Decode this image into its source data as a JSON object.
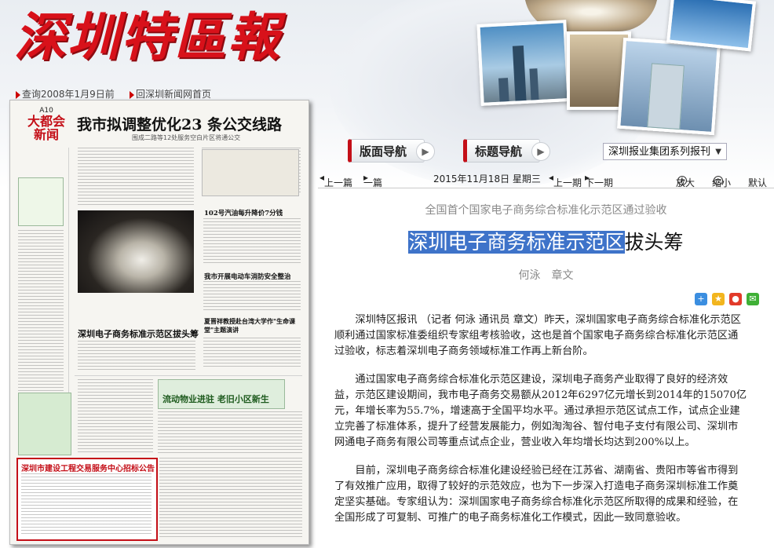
{
  "header": {
    "masthead": "深圳特區報",
    "links": [
      {
        "label": "查询2008年1月9日前"
      },
      {
        "label": "回深圳新闻网首页"
      }
    ]
  },
  "nav": {
    "layout_nav_label": "版面导航",
    "title_nav_label": "标题导航",
    "newspaper_select": "深圳报业集团系列报刊"
  },
  "toolbar": {
    "prev_article": "上一篇",
    "next_article": "一篇",
    "date": "2015年11月18日 星期三",
    "prev_issue": "上一期",
    "next_issue": "下一期",
    "zoom_in": "放大",
    "zoom_out": "缩小",
    "default": "默认"
  },
  "thumbnail": {
    "page_no": "A10",
    "section": "大都会新闻",
    "headline": "我市拟调整优化23 条公交线路",
    "sub": "围成二路等12处服务空白片区将通公交",
    "story1": "深圳电子商务标准示范区拔头筹",
    "story2": "流动物业进驻 老旧小区新生",
    "story3": "夏晋祥教授赴台湾大学作\"生命课堂\"主题演讲",
    "story4": "我市开展电动车消防安全整治",
    "story5": "102号汽油每升降价7分钱",
    "ad_title": "深圳市建设工程交易服务中心招标公告"
  },
  "article": {
    "subtitle": "全国首个国家电子商务综合标准化示范区通过验收",
    "title_highlight": "深圳电子商务标准示范区",
    "title_rest": "拔头筹",
    "byline": "何泳　章文",
    "paragraphs": [
      "深圳特区报讯 （记者 何泳 通讯员 章文）昨天，深圳国家电子商务综合标准化示范区顺利通过国家标准委组织专家组考核验收，这也是首个国家电子商务综合标准化示范区通过验收，标志着深圳电子商务领域标准工作再上新台阶。",
      "通过国家电子商务综合标准化示范区建设，深圳电子商务产业取得了良好的经济效益，示范区建设期间，我市电子商务交易额从2012年6297亿元增长到2014年的15070亿元，年增长率为55.7%，增速高于全国平均水平。通过承担示范区试点工作，试点企业建立完善了标准体系，提升了经营发展能力，例如淘淘谷、智付电子支付有限公司、深圳市网通电子商务有限公司等重点试点企业，营业收入年均增长均达到200%以上。",
      "目前，深圳电子商务综合标准化建设经验已经在江苏省、湖南省、贵阳市等省市得到了有效推广应用，取得了较好的示范效应，也为下一步深入打造电子商务深圳标准工作奠定坚实基础。专家组认为：深圳国家电子商务综合标准化示范区所取得的成果和经验，在全国形成了可复制、可推广的电子商务标准化工作模式，因此一致同意验收。"
    ]
  }
}
